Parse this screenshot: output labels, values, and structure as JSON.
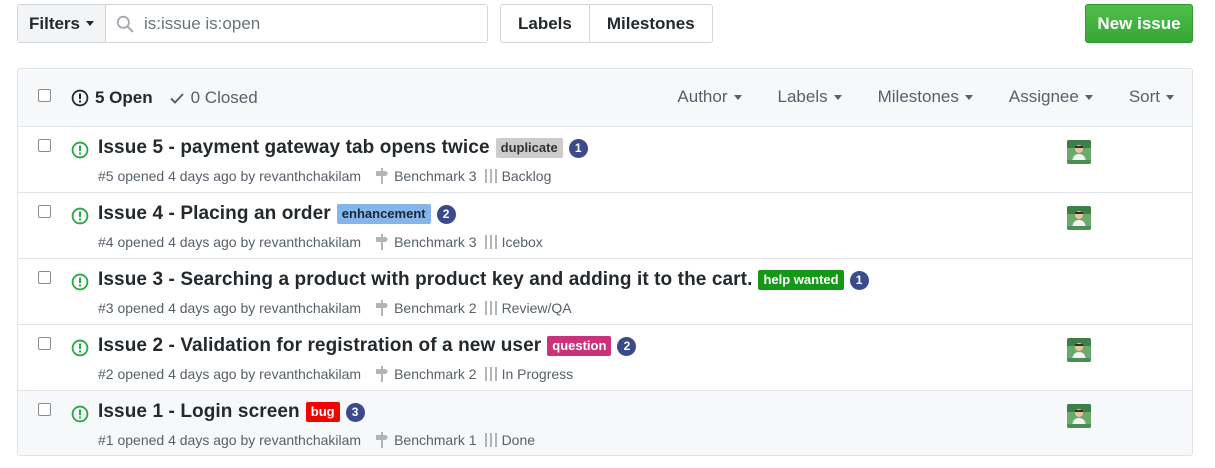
{
  "toolbar": {
    "filters_label": "Filters",
    "search_value": "is:issue is:open",
    "labels_label": "Labels",
    "milestones_label": "Milestones",
    "new_issue_label": "New issue",
    "new_issue_color": "#41b33f"
  },
  "header": {
    "open_label": "5 Open",
    "closed_label": "0 Closed",
    "filters": [
      "Author",
      "Labels",
      "Milestones",
      "Assignee",
      "Sort"
    ]
  },
  "issues": [
    {
      "title": "Issue 5 - payment gateway tab opens twice",
      "label": {
        "name": "duplicate",
        "bg": "#cccccc",
        "fg": "#333333"
      },
      "comments": "1",
      "meta": "#5 opened 4 days ago by revanthchakilam",
      "milestone": "Benchmark 3",
      "project": "Backlog",
      "assignee": true
    },
    {
      "title": "Issue 4 - Placing an order",
      "label": {
        "name": "enhancement",
        "bg": "#84b6eb",
        "fg": "#1c2733"
      },
      "comments": "2",
      "meta": "#4 opened 4 days ago by revanthchakilam",
      "milestone": "Benchmark 3",
      "project": "Icebox",
      "assignee": true
    },
    {
      "title": "Issue 3 - Searching a product with product key and adding it to the cart.",
      "label": {
        "name": "help wanted",
        "bg": "#159818",
        "fg": "#ffffff"
      },
      "comments": "1",
      "meta": "#3 opened 4 days ago by revanthchakilam",
      "milestone": "Benchmark 2",
      "project": "Review/QA",
      "assignee": false
    },
    {
      "title": "Issue 2 - Validation for registration of a new user",
      "label": {
        "name": "question",
        "bg": "#cc317c",
        "fg": "#ffffff"
      },
      "comments": "2",
      "meta": "#2 opened 4 days ago by revanthchakilam",
      "milestone": "Benchmark 2",
      "project": "In Progress",
      "assignee": true
    },
    {
      "title": "Issue 1 - Login screen",
      "label": {
        "name": "bug",
        "bg": "#ee0701",
        "fg": "#ffffff"
      },
      "comments": "3",
      "meta": "#1 opened 4 days ago by revanthchakilam",
      "milestone": "Benchmark 1",
      "project": "Done",
      "assignee": true
    }
  ],
  "colors": {
    "open_green": "#28a745",
    "badge_blue": "#3b4a8c"
  },
  "icons": {
    "search": "search-icon",
    "open_state": "issue-opened-icon",
    "closed_state": "check-icon",
    "milestone": "milestone-icon",
    "project": "project-icon",
    "caret": "caret-down-icon"
  }
}
